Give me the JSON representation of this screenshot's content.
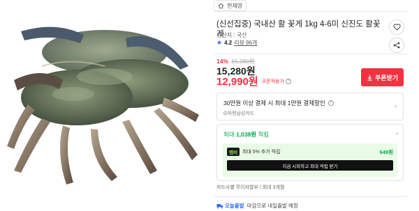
{
  "seller": {
    "name": "현재영"
  },
  "product": {
    "title": "(신선집중) 국내산 활 꽃게 1kg 4-6미 신진도 활꽃게",
    "origin": "원산지 : 국산",
    "rating_score": "4.2",
    "review_count": "리뷰 96개"
  },
  "price": {
    "discount_rate": "14%",
    "original_price": "15,280원",
    "sale_price": "15,280원",
    "coupon_price": "12,990원",
    "coupon_label": "쿠폰적용가"
  },
  "coupon_button": {
    "label": "쿠폰받기"
  },
  "card_benefit": {
    "headline": "30만원 이상 결제 시 최대 1만원 결제할인",
    "card_name": "G마켓삼성카드"
  },
  "reward": {
    "headline_prefix": "최대",
    "headline_amount": "1,038원",
    "headline_suffix": "적립",
    "member_badge": "멤버",
    "member_text": "최대 5% 추가 적립",
    "member_amount": "649원",
    "member_cta": "지금 시작하고 최대 적립 받기"
  },
  "installment": {
    "text": "카드사별 무이자할부 / 최대 3개월"
  },
  "delivery": {
    "badge": "오늘출발",
    "text": "마감으로 내일출발 예정"
  },
  "colors": {
    "accent": "#f43142",
    "green": "#03a94d",
    "blue": "#2a6bf2"
  }
}
